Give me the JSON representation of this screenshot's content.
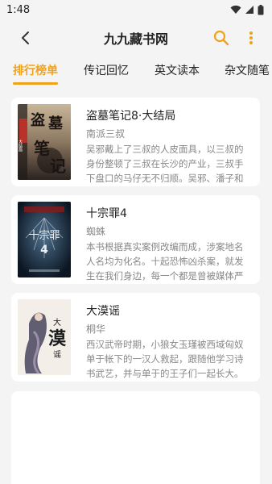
{
  "status_bar": {
    "time": "1:48"
  },
  "header": {
    "title": "九九藏书网"
  },
  "icons": {
    "back": "back-arrow-icon",
    "search": "search-icon",
    "more": "more-vertical-icon",
    "accent": "#f0a21b"
  },
  "tabs": [
    {
      "label": "排行榜单",
      "active": true
    },
    {
      "label": "传记回忆",
      "active": false
    },
    {
      "label": "英文读本",
      "active": false
    },
    {
      "label": "杂文随笔",
      "active": false
    }
  ],
  "books": [
    {
      "title": "盗墓笔记8·大结局",
      "author": "南派三叔",
      "description": "吴邪戴上了三叔的人皮面具，以三叔的身份整顿了三叔在长沙的产业，三叔手下盘口的马仔无不归顺。吴邪、潘子和小花一起……",
      "cover_text": [
        "盗",
        "墓",
        "笔",
        "记",
        "大结局"
      ]
    },
    {
      "title": "十宗罪4",
      "author": "蜘蛛",
      "description": "本书根据真实案例改编而成，涉案地名人名均为化名。十起恐怖凶杀案，就发生在我们身边，每一个都是曾被媒体严密封锁……",
      "cover_text": [
        "十宗罪",
        "4"
      ]
    },
    {
      "title": "大漠谣",
      "author": "桐华",
      "description": "西汉武帝时期，小狼女玉瑾被西域匈奴单于帐下的一汉人救起，跟随他学习诗书武艺，并与单于的王子们一起长大。匈奴……",
      "cover_text": [
        "大",
        "漠",
        "谣"
      ]
    }
  ]
}
